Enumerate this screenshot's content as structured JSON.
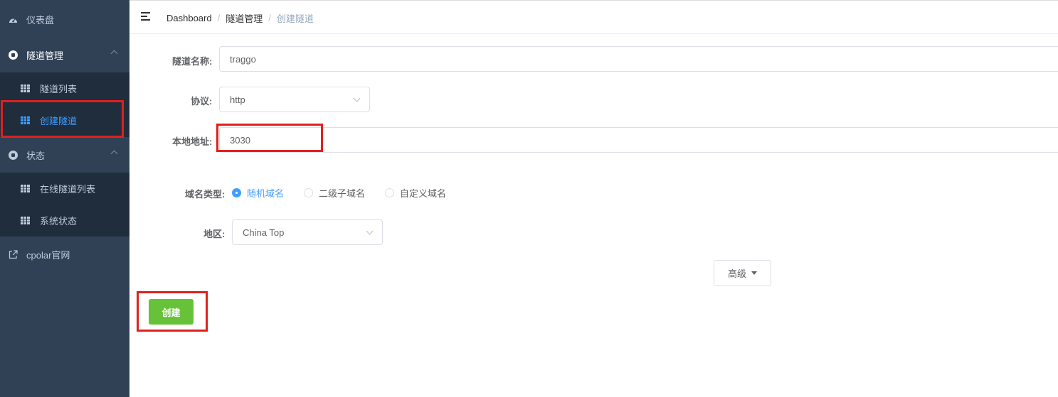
{
  "sidebar": {
    "dashboard": "仪表盘",
    "tunnel_mgmt": "隧道管理",
    "tunnel_list": "隧道列表",
    "create_tunnel": "创建隧道",
    "status": "状态",
    "online_tunnels": "在线隧道列表",
    "system_status": "系统状态",
    "cpolar_site": "cpolar官网"
  },
  "breadcrumb": [
    "Dashboard",
    "隧道管理",
    "创建隧道"
  ],
  "form": {
    "name_label": "隧道名称:",
    "name_value": "traggo",
    "protocol_label": "协议:",
    "protocol_value": "http",
    "local_addr_label": "本地地址:",
    "local_addr_value": "3030",
    "domain_type_label": "域名类型:",
    "domain_types": [
      "随机域名",
      "二级子域名",
      "自定义域名"
    ],
    "domain_type_selected": "随机域名",
    "region_label": "地区:",
    "region_value": "China Top",
    "advanced_label": "高级",
    "create_label": "创建"
  },
  "colors": {
    "sidebar_bg": "#304156",
    "submenu_bg": "#1f2d3d",
    "active": "#409eff",
    "create_button": "#67c23a",
    "highlight": "#e0201d"
  }
}
